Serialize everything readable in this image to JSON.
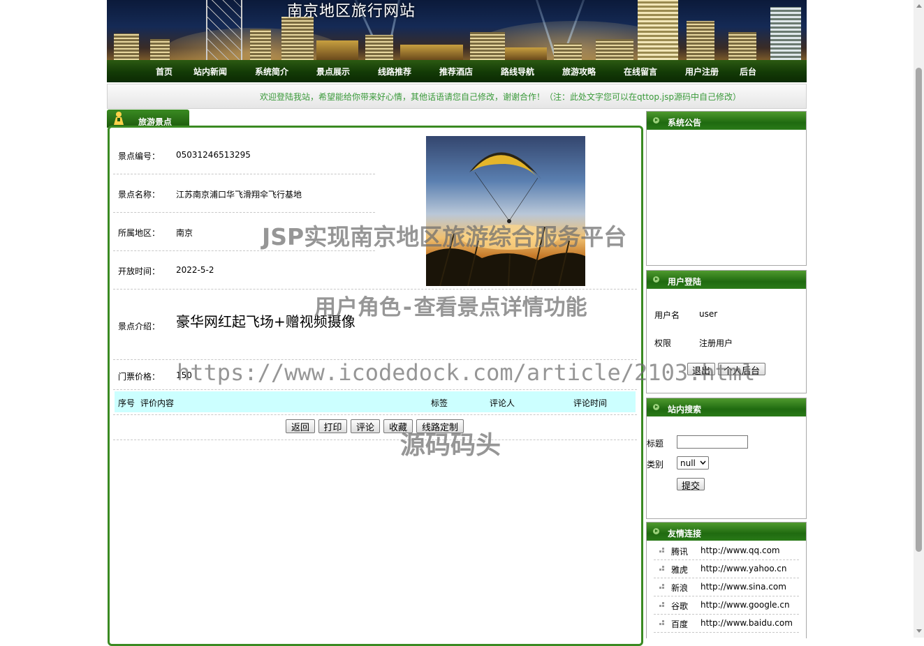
{
  "site": {
    "title": "南京地区旅行网站"
  },
  "nav": [
    "首页",
    "站内新闻",
    "系统简介",
    "景点展示",
    "线路推荐",
    "推荐酒店",
    "路线导航",
    "旅游攻略",
    "在线留言",
    "用户注册",
    "后台"
  ],
  "welcome": "欢迎登陆我站，希望能给你带来好心情，其他话语请您自己修改，谢谢合作！（注：此处文字您可以在qttop.jsp源码中自己修改）",
  "section_title": "旅游景点",
  "detail": {
    "code_label": "景点编号：",
    "code": "05031246513295",
    "name_label": "景点名称：",
    "name": "江苏南京浦口华飞滑翔伞飞行基地",
    "region_label": "所属地区：",
    "region": "南京",
    "open_label": "开放时间：",
    "open": "2022-5-2",
    "intro_label": "景点介绍：",
    "intro": "豪华网红起飞场+赠视频摄像",
    "price_label": "门票价格：",
    "price": "150"
  },
  "photo": {
    "icon": "paraglider-photo"
  },
  "comments_header": {
    "index": "序号",
    "content": "评价内容",
    "tag": "标签",
    "reviewer": "评论人",
    "time": "评论时间"
  },
  "actions": {
    "back": "返回",
    "print": "打印",
    "comment": "评论",
    "favorite": "收藏",
    "route": "线路定制"
  },
  "sidebar": {
    "notice": {
      "title": "系统公告"
    },
    "login": {
      "title": "用户登陆",
      "user_label": "用户名",
      "user_value": "user",
      "role_label": "权限",
      "role_value": "注册用户",
      "logout": "退出",
      "personal": "个人后台"
    },
    "search": {
      "title": "站内搜索",
      "title_label": "标题",
      "type_label": "类别",
      "type_value": "null",
      "submit": "提交"
    },
    "links": {
      "title": "友情连接",
      "items": [
        {
          "name": "腾讯",
          "url": "http://www.qq.com"
        },
        {
          "name": "雅虎",
          "url": "http://www.yahoo.cn"
        },
        {
          "name": "新浪",
          "url": "http://www.sina.com"
        },
        {
          "name": "谷歌",
          "url": "http://www.google.cn"
        },
        {
          "name": "百度",
          "url": "http://www.baidu.com"
        }
      ]
    }
  },
  "watermarks": {
    "title": "JSP实现南京地区旅游综合服务平台",
    "subtitle": "用户角色-查看景点详情功能",
    "url": "https://www.icodedock.com/article/2103.html",
    "brand": "源码码头"
  },
  "colors": {
    "nav_green": "#133a06",
    "accent_green": "#3a8a22",
    "welcome_text": "#3a9a3a",
    "table_head": "#ccffff"
  }
}
